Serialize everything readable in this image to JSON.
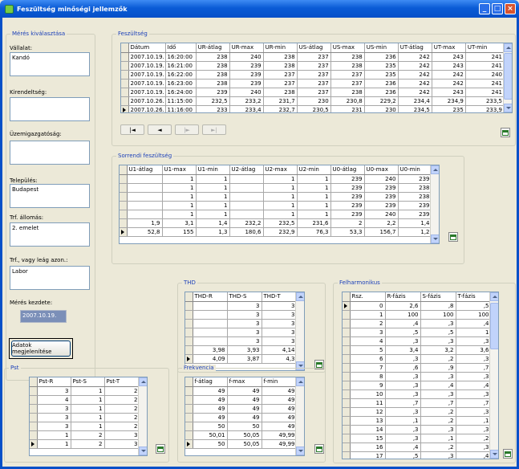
{
  "window": {
    "title": "Feszültség minőségi jellemzők"
  },
  "sel": {
    "title": "Mérés kiválasztása",
    "f1": "Vállalat:",
    "v1": "Kandó",
    "f2": "Kirendeltség:",
    "v2": "",
    "f3": "Üzemigazgatóság:",
    "v3": "",
    "f4": "Település:",
    "v4": "Budapest",
    "f5": "Trf. állomás:",
    "v5": "2. emelet",
    "f6": "Trf., vagy leág azon.:",
    "v6": "Labor",
    "f7": "Mérés kezdete:",
    "v7": "2007.10.19.",
    "btn": "Adatok megjelenítése"
  },
  "feszultseg": {
    "title": "Feszültség",
    "cols": [
      "Dátum",
      "Idő",
      "UR-átlag",
      "UR-max",
      "UR-min",
      "US-átlag",
      "US-max",
      "US-min",
      "UT-átlag",
      "UT-max",
      "UT-min"
    ],
    "rows": [
      [
        "2007.10.19.",
        "16:20:00",
        "238",
        "240",
        "238",
        "237",
        "238",
        "236",
        "242",
        "243",
        "241"
      ],
      [
        "2007.10.19.",
        "16:21:00",
        "238",
        "239",
        "238",
        "237",
        "238",
        "235",
        "242",
        "243",
        "241"
      ],
      [
        "2007.10.19.",
        "16:22:00",
        "238",
        "239",
        "237",
        "237",
        "237",
        "235",
        "242",
        "242",
        "240"
      ],
      [
        "2007.10.19.",
        "16:23:00",
        "238",
        "239",
        "237",
        "237",
        "237",
        "236",
        "242",
        "242",
        "241"
      ],
      [
        "2007.10.19.",
        "16:24:00",
        "239",
        "240",
        "238",
        "237",
        "238",
        "236",
        "242",
        "243",
        "241"
      ],
      [
        "2007.10.26.",
        "11:15:00",
        "232,5",
        "233,2",
        "231,7",
        "230",
        "230,8",
        "229,2",
        "234,4",
        "234,9",
        "233,5"
      ],
      [
        "2007.10.26.",
        "11:16:00",
        "233",
        "233,4",
        "232,7",
        "230,5",
        "231",
        "230",
        "234,5",
        "235",
        "233,9"
      ]
    ],
    "cur": 6
  },
  "sorrendi": {
    "title": "Sorrendi feszültség",
    "cols": [
      "U1-átlag",
      "U1-max",
      "U1-min",
      "U2-átlag",
      "U2-max",
      "U2-min",
      "U0-átlag",
      "U0-max",
      "U0-min"
    ],
    "rows": [
      [
        "",
        "1",
        "1",
        "",
        "1",
        "1",
        "239",
        "240",
        "239"
      ],
      [
        "",
        "1",
        "1",
        "",
        "1",
        "1",
        "239",
        "239",
        "238"
      ],
      [
        "",
        "1",
        "1",
        "",
        "1",
        "1",
        "239",
        "239",
        "238"
      ],
      [
        "",
        "1",
        "1",
        "",
        "1",
        "1",
        "239",
        "239",
        "239"
      ],
      [
        "",
        "1",
        "1",
        "",
        "1",
        "1",
        "239",
        "240",
        "239"
      ],
      [
        "1,9",
        "3,1",
        "1,4",
        "232,2",
        "232,5",
        "231,6",
        "2",
        "2,2",
        "1,4"
      ],
      [
        "52,8",
        "155",
        "1,3",
        "180,6",
        "232,9",
        "76,3",
        "53,3",
        "156,7",
        "1,2"
      ]
    ],
    "cur": 6
  },
  "thd": {
    "title": "THD",
    "cols": [
      "THD-R",
      "THD-S",
      "THD-T"
    ],
    "rows": [
      [
        "",
        "3",
        "3"
      ],
      [
        "",
        "3",
        "3"
      ],
      [
        "",
        "3",
        "3"
      ],
      [
        "",
        "3",
        "3"
      ],
      [
        "",
        "3",
        "3"
      ],
      [
        "3,98",
        "3,93",
        "4,14"
      ],
      [
        "4,09",
        "3,87",
        "4,3"
      ]
    ],
    "cur": 6
  },
  "felharm": {
    "title": "Felharmonikus",
    "cols": [
      "Rsz.",
      "R-fázis",
      "S-fázis",
      "T-fázis"
    ],
    "rows": [
      [
        "0",
        "2,6",
        ",8",
        ",5"
      ],
      [
        "1",
        "100",
        "100",
        "100"
      ],
      [
        "2",
        ",4",
        ",3",
        ",4"
      ],
      [
        "3",
        ",5",
        ",5",
        "1"
      ],
      [
        "4",
        ",3",
        ",3",
        ",3"
      ],
      [
        "5",
        "3,4",
        "3,2",
        "3,6"
      ],
      [
        "6",
        ",3",
        ",2",
        ",3"
      ],
      [
        "7",
        ",6",
        ",9",
        ",7"
      ],
      [
        "8",
        ",3",
        ",3",
        ",3"
      ],
      [
        "9",
        ",3",
        ",4",
        ",4"
      ],
      [
        "10",
        ",3",
        ",3",
        ",3"
      ],
      [
        "11",
        ",7",
        ",7",
        ",7"
      ],
      [
        "12",
        ",3",
        ",2",
        ",3"
      ],
      [
        "13",
        ",1",
        ",2",
        ",1"
      ],
      [
        "14",
        ",3",
        ",3",
        ",3"
      ],
      [
        "15",
        ",3",
        ",1",
        ",2"
      ],
      [
        "16",
        ",4",
        ",2",
        ",3"
      ],
      [
        "17",
        ",5",
        ",3",
        ",4"
      ]
    ],
    "cur": 0
  },
  "pst": {
    "title": "Pst",
    "cols": [
      "Pst-R",
      "Pst-S",
      "Pst-T"
    ],
    "rows": [
      [
        "3",
        "1",
        "2"
      ],
      [
        "4",
        "1",
        "2"
      ],
      [
        "3",
        "1",
        "2"
      ],
      [
        "3",
        "1",
        "2"
      ],
      [
        "3",
        "1",
        "2"
      ],
      [
        "1",
        "2",
        "3"
      ],
      [
        "1",
        "2",
        "3"
      ]
    ],
    "cur": 6
  },
  "frek": {
    "title": "Frekvencia",
    "cols": [
      "f-átlag",
      "f-max",
      "f-min"
    ],
    "rows": [
      [
        "49",
        "49",
        "49"
      ],
      [
        "49",
        "49",
        "49"
      ],
      [
        "49",
        "49",
        "49"
      ],
      [
        "49",
        "49",
        "49"
      ],
      [
        "50",
        "50",
        "49"
      ],
      [
        "50,01",
        "50,05",
        "49,99"
      ],
      [
        "50",
        "50,05",
        "49,99"
      ]
    ],
    "cur": 6
  },
  "nav": {
    "first": "|◄",
    "prev": "◄",
    "next": "|►",
    "last": "►|"
  }
}
